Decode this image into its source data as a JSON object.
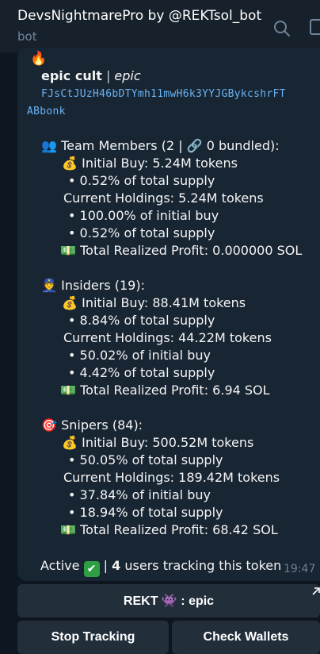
{
  "header": {
    "title": "DevsNightmarePro by @REKTsol_bot",
    "subtitle": "bot"
  },
  "message": {
    "fire_emoji": "🔥",
    "token_name": "epic cult",
    "separator": " | ",
    "token_symbol": "epic",
    "address_line1": "FJsCtJUzH46bDTYmh11mwH6k3YYJGBykcshrFT",
    "address_line2": "ABbonk",
    "team": {
      "icon": "👥",
      "heading": "Team Members (2 | 🔗 0 bundled):",
      "initial_buy": "Initial Buy: 5.24M tokens",
      "initial_pct": "• 0.52% of total supply",
      "holdings": "Current Holdings: 5.24M tokens",
      "holdings_pct_initial": "• 100.00% of initial buy",
      "holdings_pct_supply": "• 0.52% of total supply",
      "profit": "Total Realized Profit: 0.000000 SOL"
    },
    "insiders": {
      "icon": "👮",
      "heading": "Insiders (19):",
      "initial_buy": "Initial Buy: 88.41M tokens",
      "initial_pct": "• 8.84% of total supply",
      "holdings": "Current Holdings: 44.22M tokens",
      "holdings_pct_initial": "• 50.02% of initial buy",
      "holdings_pct_supply": "• 4.42% of total supply",
      "profit": "Total Realized Profit: 6.94 SOL"
    },
    "snipers": {
      "icon": "🎯",
      "heading": "Snipers (84):",
      "initial_buy": "Initial Buy: 500.52M tokens",
      "initial_pct": "• 50.05% of total supply",
      "holdings": "Current Holdings: 189.42M tokens",
      "holdings_pct_initial": "• 37.84% of initial buy",
      "holdings_pct_supply": "• 18.94% of total supply",
      "profit": "Total Realized Profit: 68.42 SOL"
    },
    "money_bag_icon": "💰",
    "money_icon": "💵",
    "footer_prefix": "Active ",
    "footer_check": "✔",
    "footer_sep": " | ",
    "footer_count": "4",
    "footer_suffix": " users tracking this token",
    "time": "19:47"
  },
  "keyboard": {
    "rekt_button": "REKT 👾 : epic",
    "stop_button": "Stop Tracking",
    "check_button": "Check Wallets"
  },
  "colors": {
    "background": "#0e1621",
    "header": "#17212b",
    "bubble": "#182533",
    "button": "#222e3a",
    "address": "#6ab3f3"
  }
}
